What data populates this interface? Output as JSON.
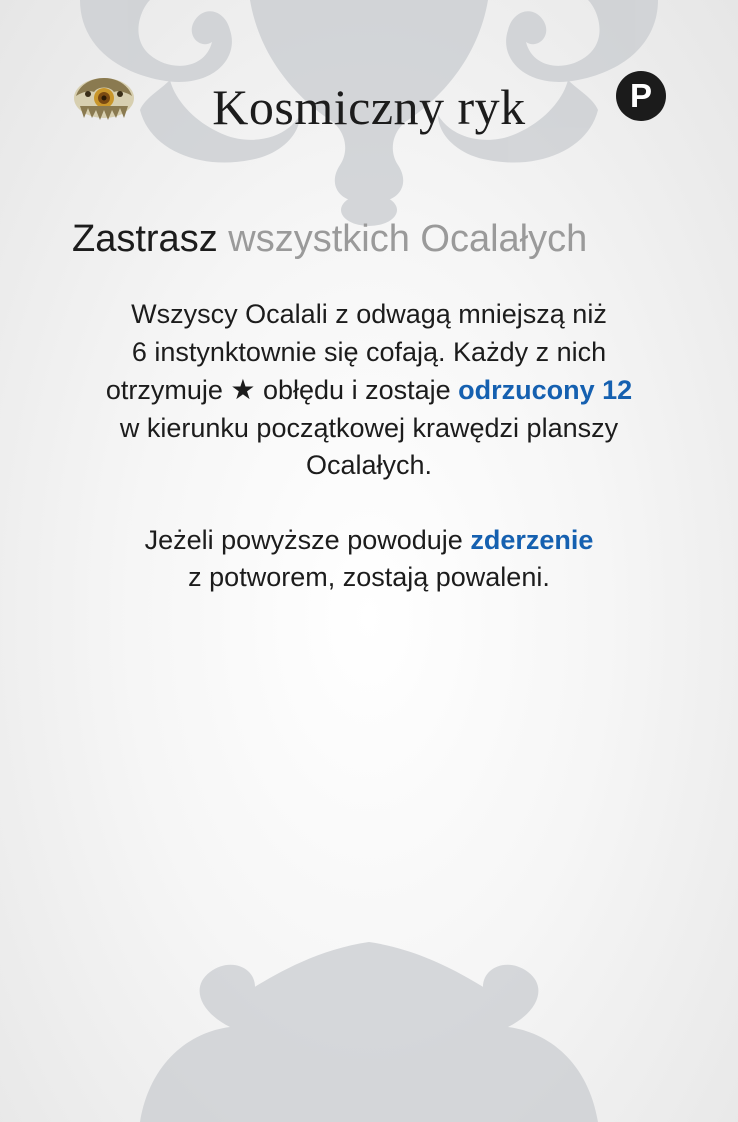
{
  "card": {
    "title": "Kosmiczny ryk",
    "badge": "P",
    "emblem_icon": "monster-emblem-icon"
  },
  "subtitle": {
    "verb": "Zastrasz",
    "rest": "wszystkich Ocalałych"
  },
  "body": {
    "p1_part1": "Wszyscy Ocalali z odwagą mniejszą niż",
    "p1_part2": "6 instynktownie się cofają. Każdy z nich",
    "p1_part3": "otrzymuje",
    "star_glyph": "★",
    "p1_part4": "obłędu i zostaje",
    "p1_keyword": "odrzucony 12",
    "p1_part5": "w kierunku początkowej krawędzi planszy",
    "p1_part6": "Ocalałych.",
    "p2_part1": "Jeżeli powyższe powoduje",
    "p2_keyword": "zderzenie",
    "p2_part2": "z potworem, zostają powaleni."
  },
  "colors": {
    "keyword": "#1560b0",
    "subtitle_rest": "#9a9a9a",
    "ornament": "#c9ccd0",
    "badge": "#1b1b1b"
  }
}
